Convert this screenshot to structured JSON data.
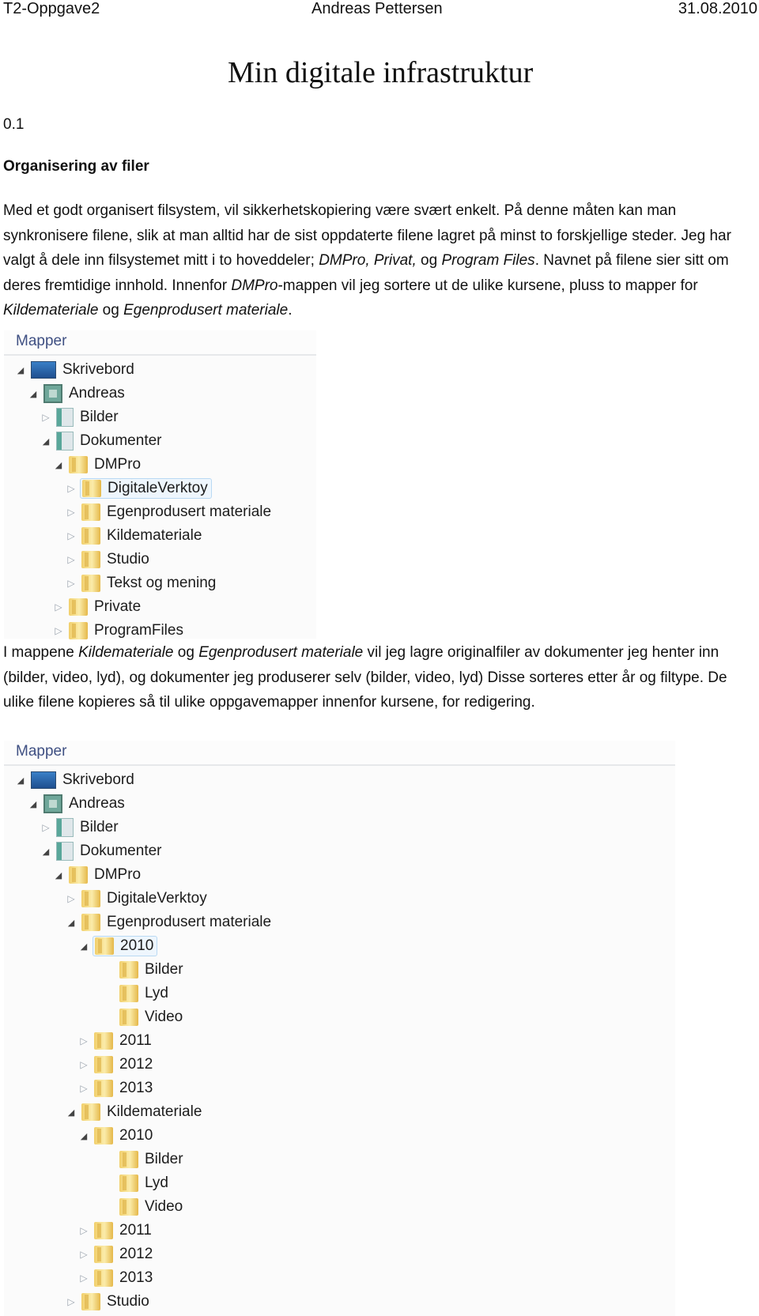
{
  "header": {
    "left": "T2-Oppgave2",
    "center": "Andreas Pettersen",
    "right": "31.08.2010"
  },
  "title": "Min digitale infrastruktur",
  "section_number": "0.1",
  "section_heading": "Organisering av filer",
  "paragraph1": {
    "t1": "Med et godt organisert filsystem, vil sikkerhetskopiering være svært enkelt. På denne måten kan man synkronisere filene, slik at man alltid har de sist oppdaterte filene lagret på minst to forskjellige steder. Jeg har valgt å dele inn filsystemet mitt i to hoveddeler;  ",
    "i1": "DMPro, Privat,",
    "t2": " og ",
    "i2": "Program Files",
    "t3": ". Navnet på filene sier sitt om deres fremtidige innhold. Innenfor ",
    "i3": "DMPro",
    "t4": "-mappen vil jeg sortere ut de ulike kursene, pluss to mapper for ",
    "i4": "Kildemateriale",
    "t5": " og ",
    "i5": "Egenprodusert materiale",
    "t6": "."
  },
  "paragraph2": {
    "t1": "I mappene ",
    "i1": "Kildemateriale",
    "t2": " og ",
    "i2": "Egenprodusert materiale",
    "t3": " vil jeg lagre originalfiler av dokumenter jeg henter inn (bilder, video, lyd), og dokumenter jeg produserer selv (bilder, video, lyd) Disse sorteres etter år og filtype. De ulike filene kopieres så til ulike oppgavemapper innenfor kursene, for redigering."
  },
  "explorer1": {
    "header": "Mapper",
    "nodes": [
      {
        "label": "Skrivebord",
        "icon": "desktop-icon",
        "state": "expanded",
        "level": 0
      },
      {
        "label": "Andreas",
        "icon": "user-folder-icon",
        "state": "expanded",
        "level": 1
      },
      {
        "label": "Bilder",
        "icon": "library-icon",
        "state": "collapsed",
        "level": 2
      },
      {
        "label": "Dokumenter",
        "icon": "library-icon",
        "state": "expanded",
        "level": 2
      },
      {
        "label": "DMPro",
        "icon": "folder-icon",
        "state": "expanded",
        "level": 3
      },
      {
        "label": "DigitaleVerktoy",
        "icon": "folder-icon",
        "state": "collapsed",
        "level": 4,
        "selected": true
      },
      {
        "label": "Egenprodusert materiale",
        "icon": "folder-icon",
        "state": "collapsed",
        "level": 4
      },
      {
        "label": "Kildemateriale",
        "icon": "folder-icon",
        "state": "collapsed",
        "level": 4
      },
      {
        "label": "Studio",
        "icon": "folder-icon",
        "state": "collapsed",
        "level": 4
      },
      {
        "label": "Tekst og mening",
        "icon": "folder-icon",
        "state": "collapsed",
        "level": 4
      },
      {
        "label": "Private",
        "icon": "folder-icon",
        "state": "collapsed",
        "level": 3
      },
      {
        "label": "ProgramFiles",
        "icon": "folder-icon",
        "state": "collapsed",
        "level": 3
      }
    ]
  },
  "explorer2": {
    "header": "Mapper",
    "nodes": [
      {
        "label": "Skrivebord",
        "icon": "desktop-icon",
        "state": "expanded",
        "level": 0
      },
      {
        "label": "Andreas",
        "icon": "user-folder-icon",
        "state": "expanded",
        "level": 1
      },
      {
        "label": "Bilder",
        "icon": "library-icon",
        "state": "collapsed",
        "level": 2
      },
      {
        "label": "Dokumenter",
        "icon": "library-icon",
        "state": "expanded",
        "level": 2
      },
      {
        "label": "DMPro",
        "icon": "folder-icon",
        "state": "expanded",
        "level": 3
      },
      {
        "label": "DigitaleVerktoy",
        "icon": "folder-icon",
        "state": "collapsed",
        "level": 4
      },
      {
        "label": "Egenprodusert materiale",
        "icon": "folder-icon",
        "state": "expanded",
        "level": 4
      },
      {
        "label": "2010",
        "icon": "folder-icon",
        "state": "expanded",
        "level": 5,
        "selected": true
      },
      {
        "label": "Bilder",
        "icon": "folder-icon",
        "state": "leaf",
        "level": 6
      },
      {
        "label": "Lyd",
        "icon": "folder-icon",
        "state": "leaf",
        "level": 6
      },
      {
        "label": "Video",
        "icon": "folder-icon",
        "state": "leaf",
        "level": 6
      },
      {
        "label": "2011",
        "icon": "folder-icon",
        "state": "collapsed",
        "level": 5
      },
      {
        "label": "2012",
        "icon": "folder-icon",
        "state": "collapsed",
        "level": 5
      },
      {
        "label": "2013",
        "icon": "folder-icon",
        "state": "collapsed",
        "level": 5
      },
      {
        "label": "Kildemateriale",
        "icon": "folder-icon",
        "state": "expanded",
        "level": 4
      },
      {
        "label": "2010",
        "icon": "folder-icon",
        "state": "expanded",
        "level": 5
      },
      {
        "label": "Bilder",
        "icon": "folder-icon",
        "state": "leaf",
        "level": 6
      },
      {
        "label": "Lyd",
        "icon": "folder-icon",
        "state": "leaf",
        "level": 6
      },
      {
        "label": "Video",
        "icon": "folder-icon",
        "state": "leaf",
        "level": 6
      },
      {
        "label": "2011",
        "icon": "folder-icon",
        "state": "collapsed",
        "level": 5
      },
      {
        "label": "2012",
        "icon": "folder-icon",
        "state": "collapsed",
        "level": 5
      },
      {
        "label": "2013",
        "icon": "folder-icon",
        "state": "collapsed",
        "level": 5
      },
      {
        "label": "Studio",
        "icon": "folder-icon",
        "state": "collapsed",
        "level": 4
      }
    ]
  }
}
